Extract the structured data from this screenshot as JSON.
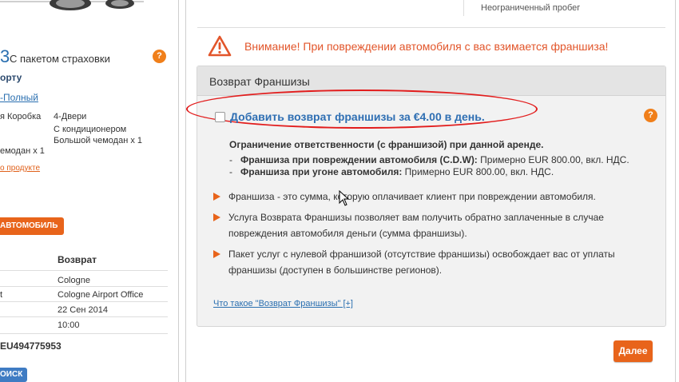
{
  "sidebar": {
    "price_fragment": "3",
    "price_label": "С пакетом страховки",
    "help_label": "?",
    "location_fragment": "орту",
    "package_link": "-Полный",
    "specs": {
      "transmission": "я Коробка",
      "doors": "4-Двери",
      "ac": "С кондиционером",
      "suitcase_large": "Большой чемодан x 1",
      "suitcase_fragment": "емодан x 1"
    },
    "product_link": "о продукте",
    "car_button": "АВТОМОБИЛЬ",
    "return_heading": "Возврат",
    "return_city": "Cologne",
    "return_office_left": "t",
    "return_office": "Cologne Airport Office",
    "return_date": "22 Сен 2014",
    "return_time": "10:00",
    "booking_ref": "EU494775953",
    "search_button": "ОИСК"
  },
  "top_note": "Неограниченный пробег",
  "warning": {
    "icon": "warning-triangle-icon",
    "text": "Внимание! При повреждении автомобиля с вас взимается франшиза!"
  },
  "panel": {
    "title": "Возврат Франшизы",
    "checkbox_label": "Добавить возврат франшизы за €4.00 в день.",
    "checkbox_checked": false,
    "help_label": "?",
    "limit_heading": "Ограничение ответственности (с франшизой) при данной аренде.",
    "limits": [
      {
        "dash": "-",
        "label": "Франшиза при повреждении автомобиля (C.D.W):",
        "value": "Примерно EUR 800.00, вкл. НДС."
      },
      {
        "dash": "-",
        "label": "Франшиза при угоне автомобиля:",
        "value": "Примерно EUR 800.00, вкл. НДС."
      }
    ],
    "bullets": [
      "Франшиза - это сумма, которую оплачивает клиент при повреждении автомобиля.",
      "Услуга Возврата Франшизы позволяет вам получить обратно заплаченные в случае повреждения автомобиля деньги (сумма франшизы).",
      "Пакет услуг с нулевой франшизой (отсутствие франшизы) освобождает вас от уплаты франшизы (доступен в большинстве регионов)."
    ],
    "what_link": "Что такое \"Возврат Франшизы\" [+]"
  },
  "next_button": "Далее",
  "colors": {
    "accent_orange": "#e8641b",
    "warning_red": "#e2552a",
    "link_blue": "#2a6fb0",
    "highlight_oval": "#e21d1d"
  }
}
